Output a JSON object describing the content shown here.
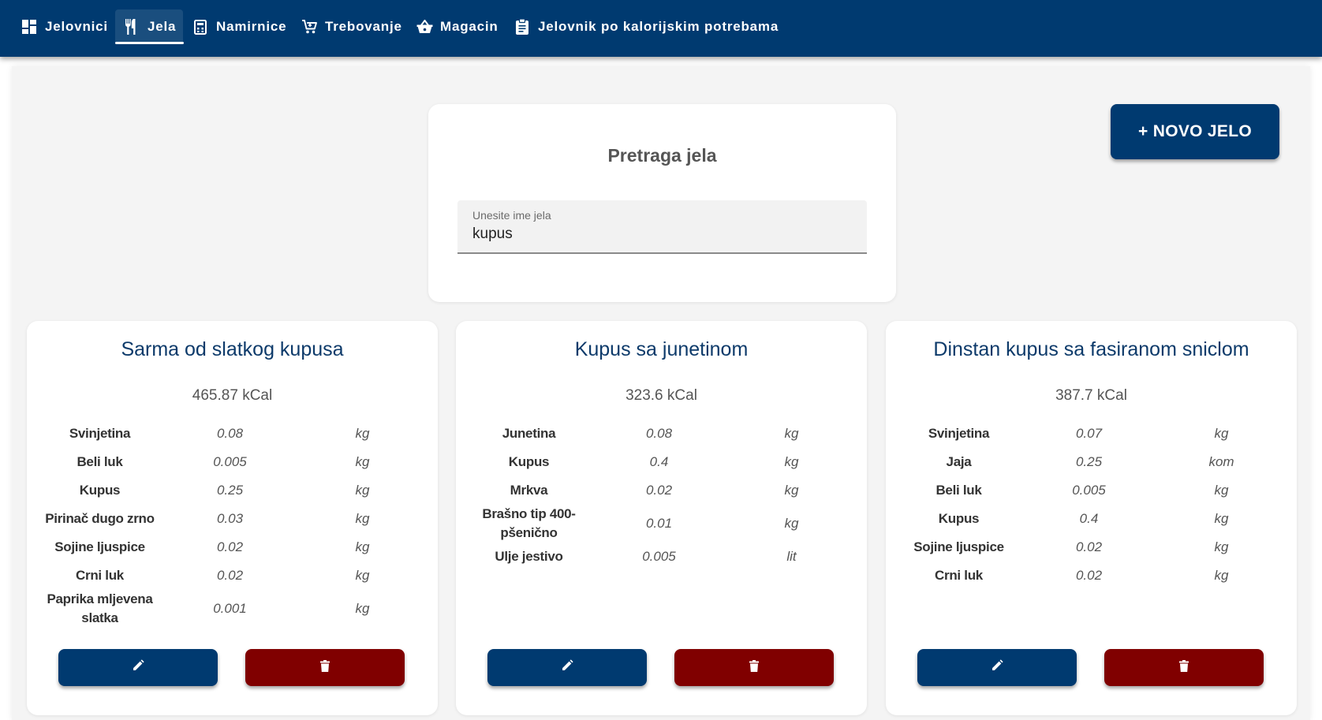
{
  "nav": {
    "items": [
      {
        "label": "Jelovnici",
        "icon": "dashboard-icon"
      },
      {
        "label": "Jela",
        "icon": "fork-knife-icon",
        "active": true
      },
      {
        "label": "Namirnice",
        "icon": "calculator-icon"
      },
      {
        "label": "Trebovanje",
        "icon": "cart-icon"
      },
      {
        "label": "Magacin",
        "icon": "basket-icon"
      },
      {
        "label": "Jelovnik po kalorijskim potrebama",
        "icon": "clipboard-icon"
      }
    ]
  },
  "search": {
    "title": "Pretraga jela",
    "field_label": "Unesite ime jela",
    "value": "kupus"
  },
  "new_button": {
    "label": "+ NOVO JELO"
  },
  "dishes": [
    {
      "title": "Sarma od slatkog kupusa",
      "kcal": "465.87 kCal",
      "ingredients": [
        {
          "name": "Svinjetina",
          "qty": "0.08",
          "unit": "kg"
        },
        {
          "name": "Beli luk",
          "qty": "0.005",
          "unit": "kg"
        },
        {
          "name": "Kupus",
          "qty": "0.25",
          "unit": "kg"
        },
        {
          "name": "Pirinač dugo zrno",
          "qty": "0.03",
          "unit": "kg"
        },
        {
          "name": "Sojine ljuspice",
          "qty": "0.02",
          "unit": "kg"
        },
        {
          "name": "Crni luk",
          "qty": "0.02",
          "unit": "kg"
        },
        {
          "name": "Paprika mljevena slatka",
          "qty": "0.001",
          "unit": "kg"
        }
      ]
    },
    {
      "title": "Kupus sa junetinom",
      "kcal": "323.6 kCal",
      "ingredients": [
        {
          "name": "Junetina",
          "qty": "0.08",
          "unit": "kg"
        },
        {
          "name": "Kupus",
          "qty": "0.4",
          "unit": "kg"
        },
        {
          "name": "Mrkva",
          "qty": "0.02",
          "unit": "kg"
        },
        {
          "name": "Brašno tip 400-pšenično",
          "qty": "0.01",
          "unit": "kg"
        },
        {
          "name": "Ulje jestivo",
          "qty": "0.005",
          "unit": "lit"
        }
      ]
    },
    {
      "title": "Dinstan kupus sa fasiranom sniclom",
      "kcal": "387.7 kCal",
      "ingredients": [
        {
          "name": "Svinjetina",
          "qty": "0.07",
          "unit": "kg"
        },
        {
          "name": "Jaja",
          "qty": "0.25",
          "unit": "kom"
        },
        {
          "name": "Beli luk",
          "qty": "0.005",
          "unit": "kg"
        },
        {
          "name": "Kupus",
          "qty": "0.4",
          "unit": "kg"
        },
        {
          "name": "Sojine ljuspice",
          "qty": "0.02",
          "unit": "kg"
        },
        {
          "name": "Crni luk",
          "qty": "0.02",
          "unit": "kg"
        }
      ]
    }
  ],
  "colors": {
    "primary": "#003a70",
    "danger": "#800000",
    "page_bg": "#f4f4f4",
    "title_text": "#0d3a6a"
  }
}
